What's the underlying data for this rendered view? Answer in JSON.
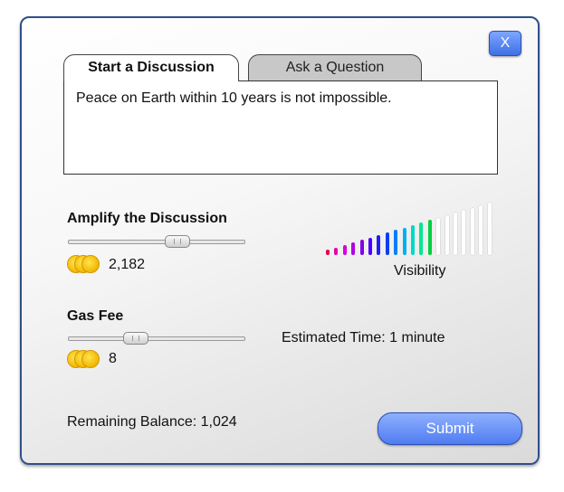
{
  "dialog": {
    "close_label": "X",
    "tabs": [
      {
        "label": "Start a Discussion",
        "active": true
      },
      {
        "label": "Ask a Question",
        "active": false
      }
    ],
    "message": "Peace on Earth within 10 years is not impossible.",
    "amplify": {
      "title": "Amplify the Discussion",
      "slider_fraction": 0.62,
      "amount": "2,182"
    },
    "visibility": {
      "label": "Visibility",
      "bars": [
        {
          "color": "#e6004c",
          "level": 0.05
        },
        {
          "color": "#e800a8",
          "level": 0.1
        },
        {
          "color": "#d800d8",
          "level": 0.15
        },
        {
          "color": "#b000e0",
          "level": 0.2
        },
        {
          "color": "#8000e8",
          "level": 0.25
        },
        {
          "color": "#4a00ff",
          "level": 0.3
        },
        {
          "color": "#2020f0",
          "level": 0.35
        },
        {
          "color": "#0040f0",
          "level": 0.4
        },
        {
          "color": "#0080ff",
          "level": 0.45
        },
        {
          "color": "#00b0f0",
          "level": 0.5
        },
        {
          "color": "#00d8c8",
          "level": 0.55
        },
        {
          "color": "#00e890",
          "level": 0.6
        },
        {
          "color": "#00d040",
          "level": 0.65
        },
        {
          "color": "#ffffff",
          "level": 0.7
        },
        {
          "color": "#ffffff",
          "level": 0.75
        },
        {
          "color": "#ffffff",
          "level": 0.8
        },
        {
          "color": "#ffffff",
          "level": 0.85
        },
        {
          "color": "#ffffff",
          "level": 0.9
        },
        {
          "color": "#ffffff",
          "level": 0.95
        },
        {
          "color": "#ffffff",
          "level": 1.0
        }
      ]
    },
    "gas_fee": {
      "title": "Gas Fee",
      "slider_fraction": 0.38,
      "amount": "8"
    },
    "estimated_time": "Estimated Time: 1 minute",
    "remaining_balance": "Remaining Balance: 1,024",
    "submit_label": "Submit"
  }
}
